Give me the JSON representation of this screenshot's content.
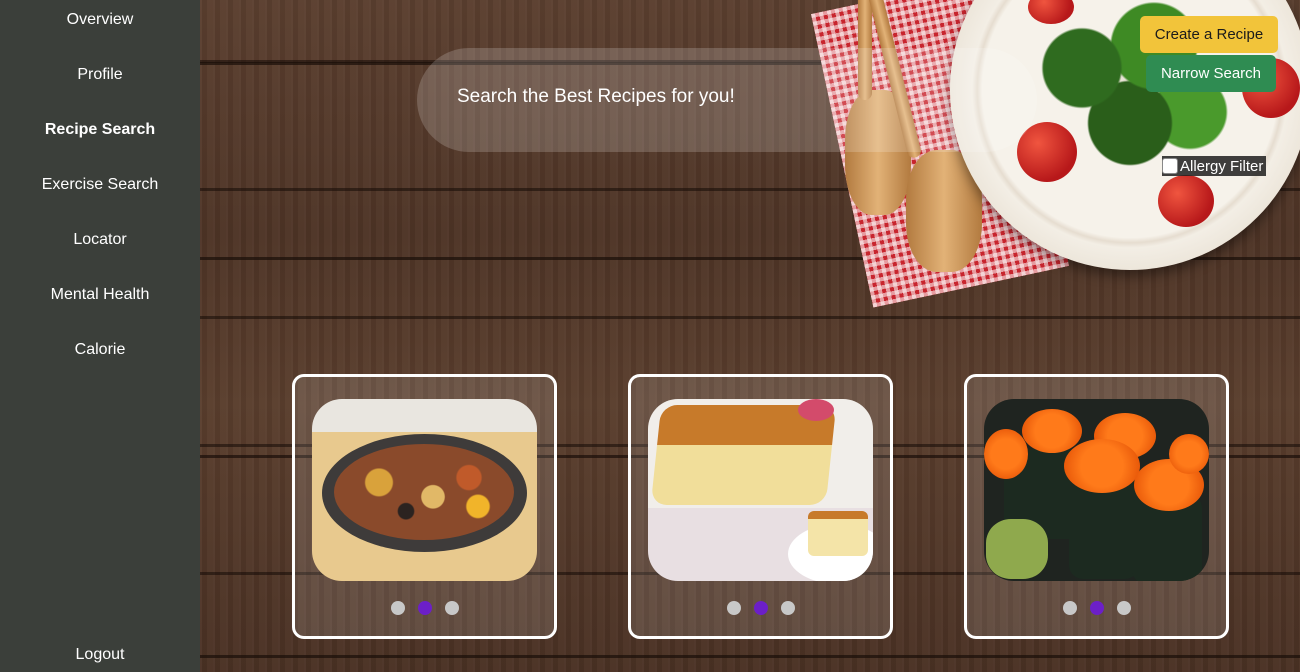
{
  "sidebar": {
    "items": [
      {
        "label": "Overview",
        "active": false
      },
      {
        "label": "Profile",
        "active": false
      },
      {
        "label": "Recipe Search",
        "active": true
      },
      {
        "label": "Exercise Search",
        "active": false
      },
      {
        "label": "Locator",
        "active": false
      },
      {
        "label": "Mental Health",
        "active": false
      },
      {
        "label": "Calorie",
        "active": false
      }
    ],
    "logout_label": "Logout"
  },
  "search": {
    "text": "Search the Best Recipes for you!"
  },
  "actions": {
    "create_label": "Create a Recipe",
    "narrow_label": "Narrow Search",
    "allergy_label": "Allergy Filter",
    "allergy_checked": false
  },
  "cards": [
    {
      "image": "stew-pan-photo",
      "active_dot": 2,
      "dot_count": 3
    },
    {
      "image": "pound-cake-photo",
      "active_dot": 2,
      "dot_count": 3
    },
    {
      "image": "sushi-rolls-photo",
      "active_dot": 2,
      "dot_count": 3
    }
  ],
  "colors": {
    "sidebar_bg": "#3b3f3a",
    "create_button": "#f2c43a",
    "narrow_button": "#2f8c52",
    "active_dot": "#6c1fc8",
    "inactive_dot": "#c8c8c8"
  }
}
